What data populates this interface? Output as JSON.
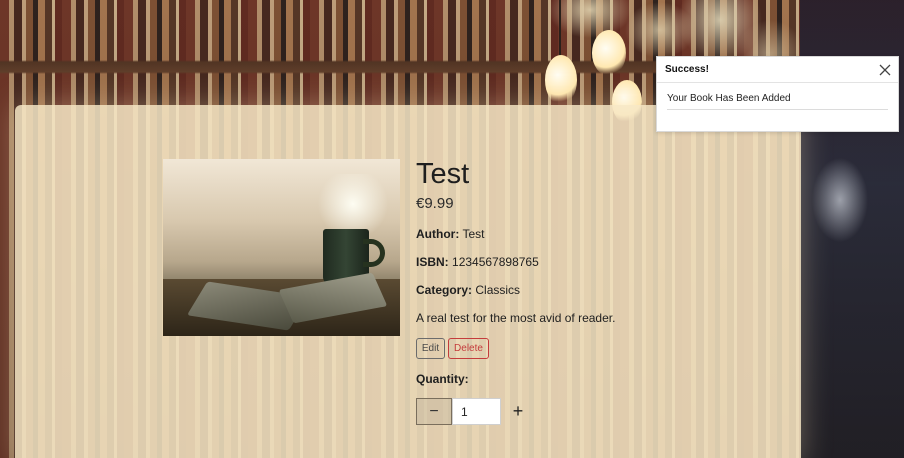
{
  "toast": {
    "title": "Success!",
    "message": "Your Book Has Been Added",
    "close_icon": "close-icon"
  },
  "product": {
    "title": "Test",
    "price": "€9.99",
    "author_label": "Author:",
    "author": "Test",
    "isbn_label": "ISBN:",
    "isbn": "1234567898765",
    "category_label": "Category:",
    "category": "Classics",
    "description": "A real test for the most avid of reader.",
    "image_icon": "book-and-coffee-image"
  },
  "actions": {
    "edit_label": "Edit",
    "delete_label": "Delete"
  },
  "quantity": {
    "label": "Quantity:",
    "value": "1",
    "minus": "−",
    "plus": "+"
  },
  "colors": {
    "panel": "#f7e8c6",
    "delete": "#c43c3c"
  }
}
